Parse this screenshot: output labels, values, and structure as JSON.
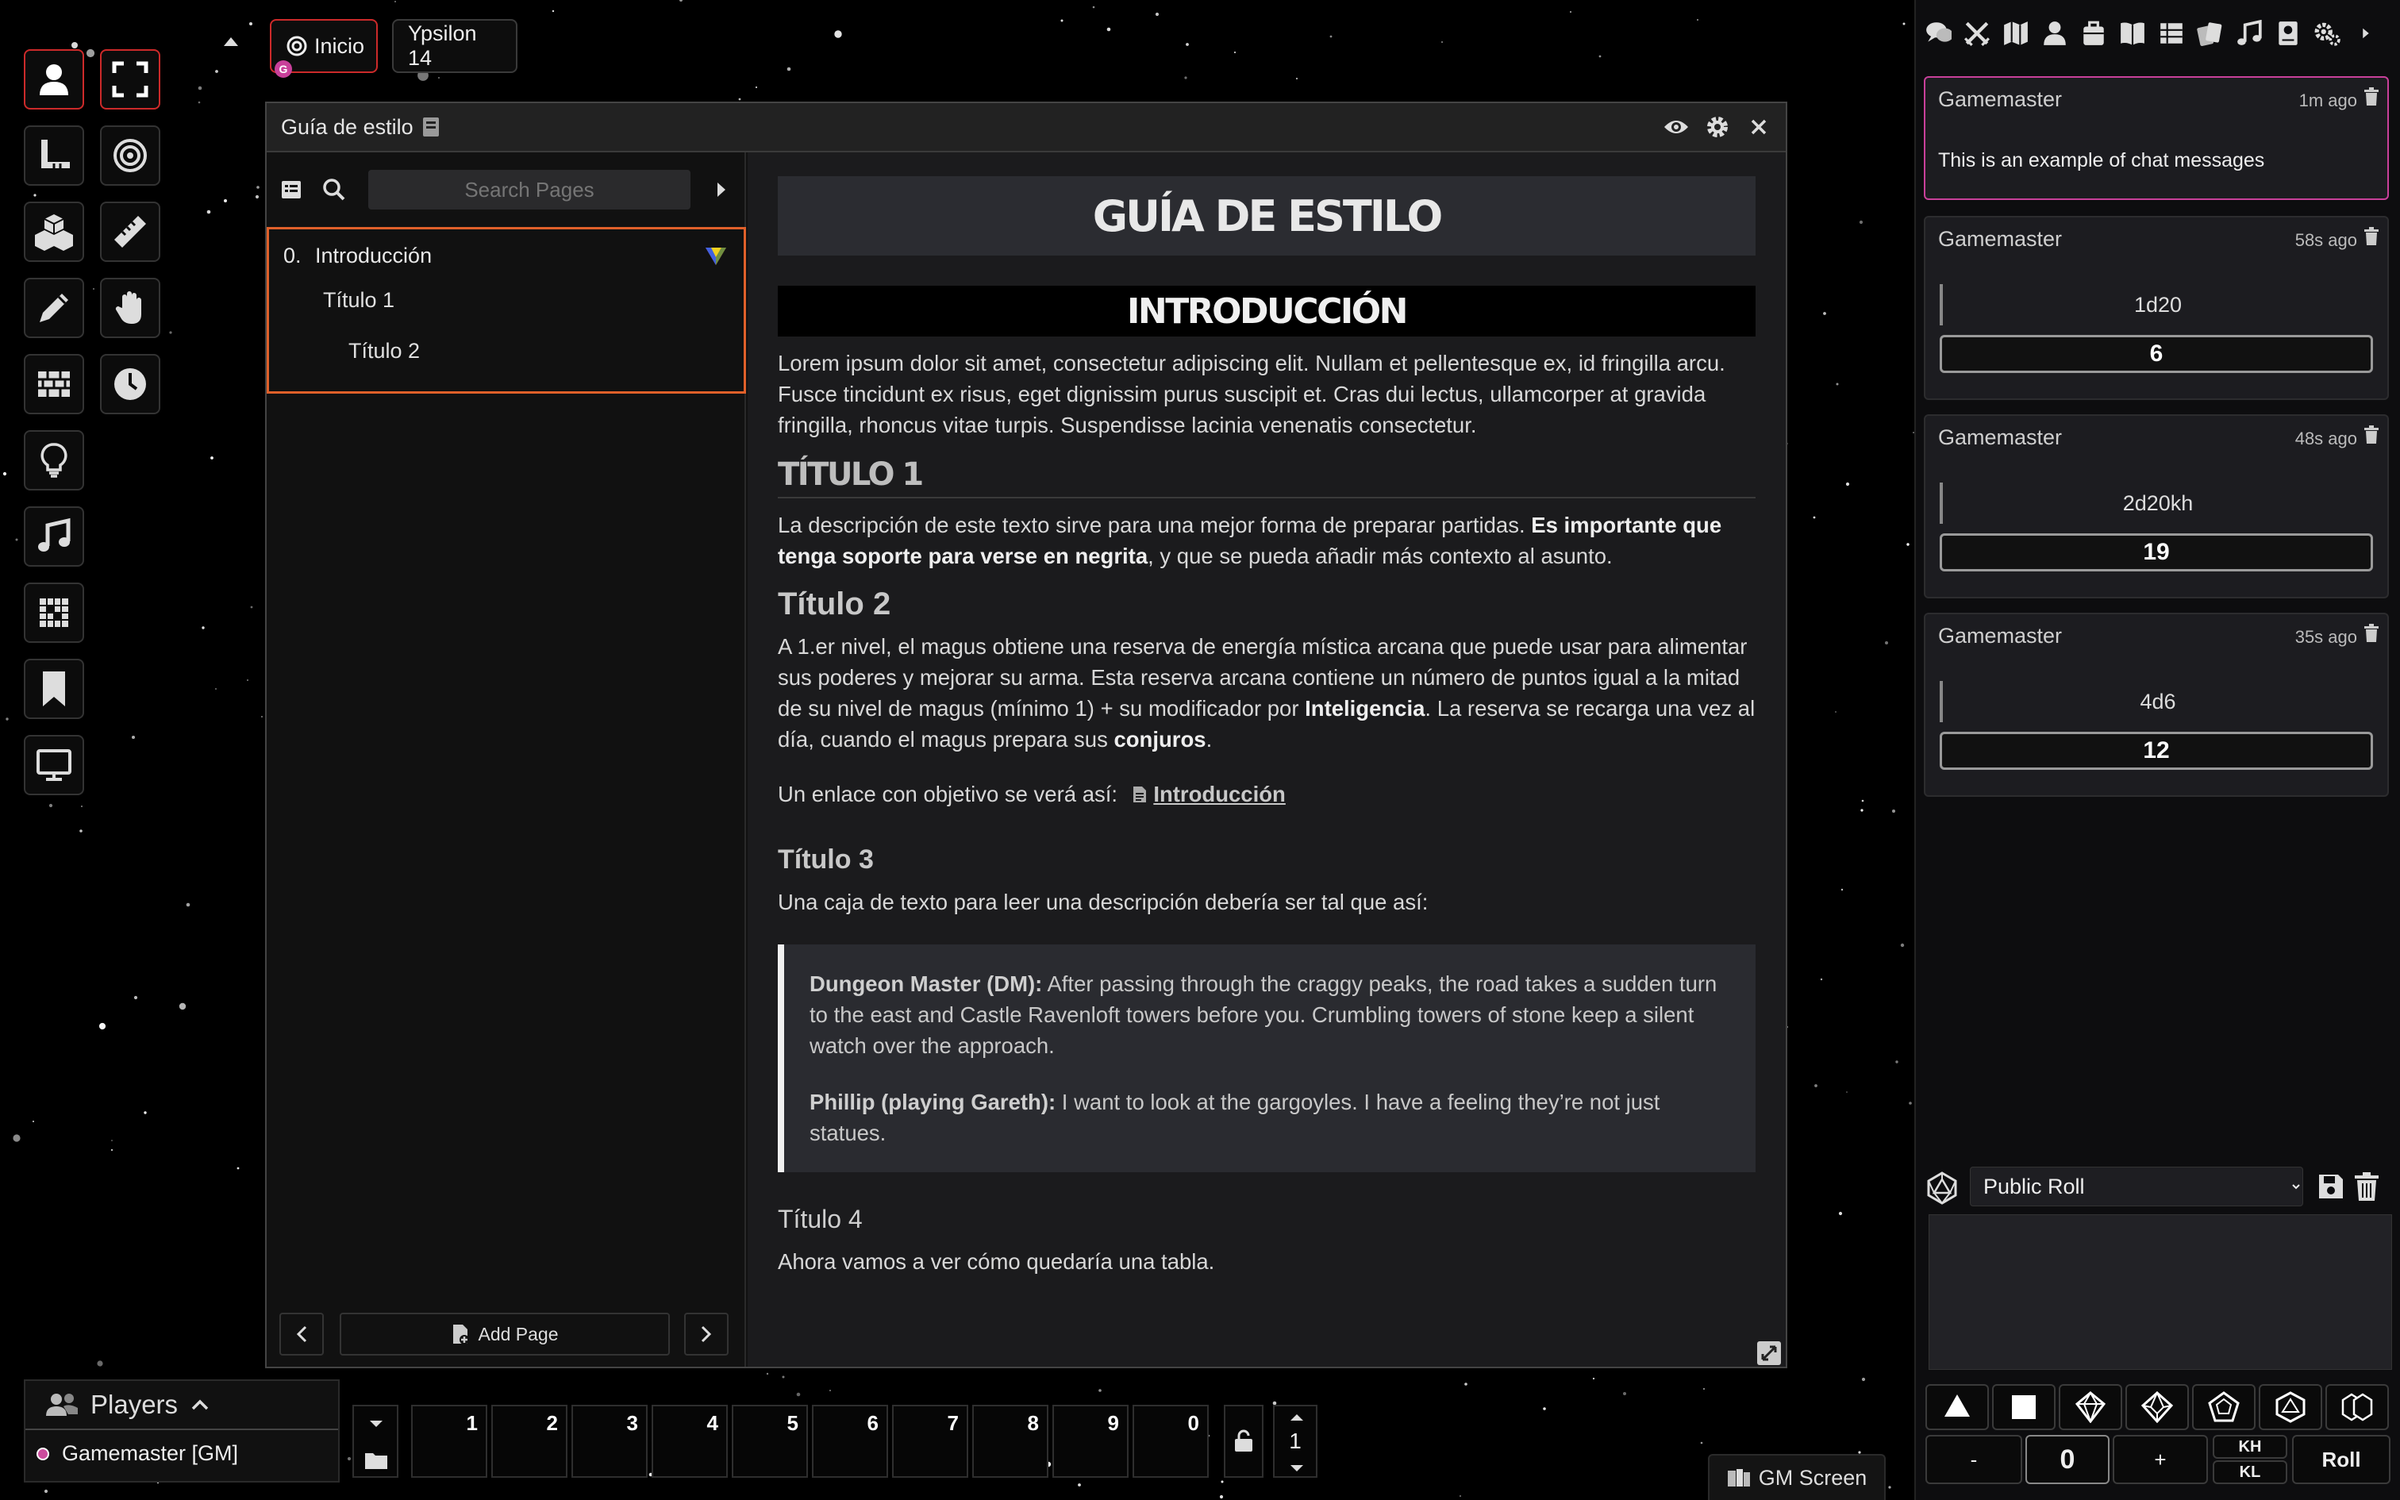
{
  "nav": {
    "tabs": [
      {
        "label": "Inicio"
      },
      {
        "label": "Ypsilon 14"
      }
    ],
    "gm_badge": "G"
  },
  "controls": [
    "token-icon",
    "fullscreen-icon",
    "measure-icon",
    "target-icon",
    "cubes-icon",
    "ruler-icon",
    "pencil-icon",
    "hand-icon",
    "wall-icon",
    "clock-icon",
    "lightbulb-icon",
    "music-icon",
    "tiles-icon",
    "bookmark-icon",
    "screen-icon"
  ],
  "journal": {
    "window_title": "Guía de estilo",
    "search_placeholder": "Search Pages",
    "pages": [
      {
        "num": "0.",
        "label": "Introducción"
      },
      {
        "label": "Título 1"
      },
      {
        "label": "Título 2"
      }
    ],
    "add_page_label": "Add Page",
    "content": {
      "banner": "GUÍA DE ESTILO",
      "h1": "INTRODUCCIÓN",
      "p1": "Lorem ipsum dolor sit amet, consectetur adipiscing elit. Nullam et pellentesque ex, id fringilla arcu. Fusce tincidunt ex risus, eget dignissim purus suscipit et. Cras dui lectus, ullamcorper at gravida fringilla, rhoncus vitae turpis. Suspendisse lacinia venenatis consectetur.",
      "h2": "TÍTULO 1",
      "p2a": "La descripción de este texto sirve para una mejor forma de preparar partidas. ",
      "p2b": "Es importante que tenga soporte para verse en negrita",
      "p2c": ", y que se pueda añadir más contexto al asunto.",
      "h3": "Título 2",
      "p3a": "A 1.er nivel, el magus obtiene una reserva de energía mística arcana que puede usar para alimentar sus poderes y mejorar su arma. Esta reserva arcana contiene un número de puntos igual a la mitad de su nivel de magus (mínimo 1) + su modificador por ",
      "p3b": "Inteligencia",
      "p3c": ". La reserva se recarga una vez al día, cuando el magus prepara sus ",
      "p3d": "conjuros",
      "p3e": ".",
      "link_intro": "Un enlace con objetivo se verá así:",
      "link_label": "Introducción",
      "h4": "Título 3",
      "p4": "Una caja de texto para leer una descripción debería ser tal que así:",
      "q1_speaker": "Dungeon Master (DM):",
      "q1_text": " After passing through the craggy peaks, the road takes a sudden turn to the east and Castle Ravenloft towers before you. Crumbling towers of stone keep a silent watch over the approach.",
      "q2_speaker": "Phillip (playing Gareth):",
      "q2_text": " I want to look at the gargoyles. I have a feeling they’re not just statues.",
      "h5": "Título 4",
      "p5": "Ahora vamos a ver cómo quedaría una tabla."
    }
  },
  "chat": {
    "tabs": [
      "chat-icon",
      "combat-icon",
      "map-icon",
      "actors-icon",
      "items-icon",
      "journal-icon",
      "tables-icon",
      "cards-icon",
      "playlists-icon",
      "compendium-icon",
      "settings-icon",
      "collapse-icon"
    ],
    "messages": [
      {
        "author": "Gamemaster",
        "time": "1m ago",
        "text": "This is an example of chat messages"
      },
      {
        "author": "Gamemaster",
        "time": "58s ago",
        "formula": "1d20",
        "total": "6"
      },
      {
        "author": "Gamemaster",
        "time": "48s ago",
        "formula": "2d20kh",
        "total": "19"
      },
      {
        "author": "Gamemaster",
        "time": "35s ago",
        "formula": "4d6",
        "total": "12"
      }
    ],
    "roll_mode": "Public Roll",
    "roll_options": [
      "Public Roll"
    ],
    "dice": [
      "d4",
      "d6",
      "d8",
      "d10",
      "d12",
      "d20",
      "d100"
    ],
    "modifier": "0",
    "minus_label": "-",
    "plus_label": "+",
    "kh_label": "KH",
    "kl_label": "KL",
    "roll_label": "Roll"
  },
  "players": {
    "title": "Players",
    "list": [
      {
        "name": "Gamemaster [GM]",
        "color": "#cc4c9d"
      }
    ]
  },
  "hotbar": {
    "slots": [
      "1",
      "2",
      "3",
      "4",
      "5",
      "6",
      "7",
      "8",
      "9",
      "0"
    ],
    "page": "1"
  },
  "gm_screen_label": "GM Screen",
  "colors": {
    "accent": "#cc2a2a",
    "active_page": "#e0602a",
    "chat_highlight": "#c8409a"
  }
}
